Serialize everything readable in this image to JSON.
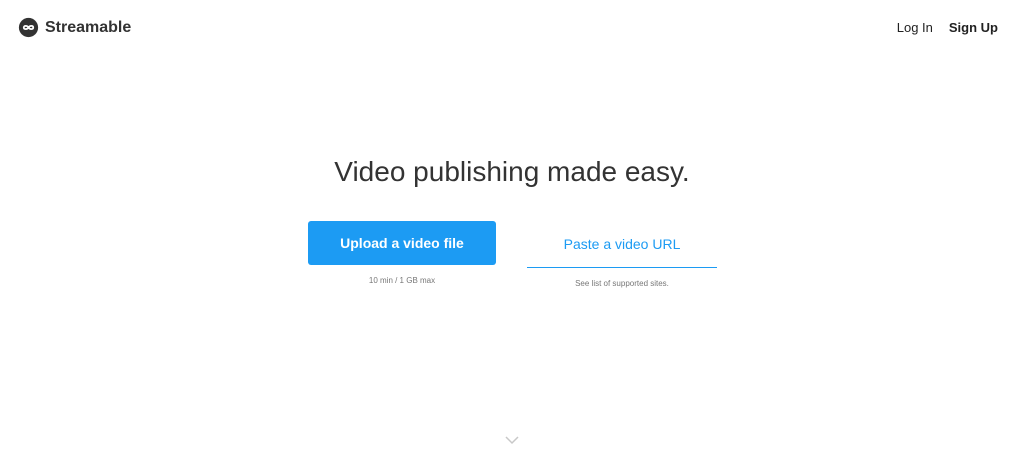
{
  "header": {
    "brand_name": "Streamable",
    "login_label": "Log In",
    "signup_label": "Sign Up"
  },
  "main": {
    "headline": "Video publishing made easy.",
    "upload_button_label": "Upload a video file",
    "upload_note": "10 min / 1 GB max",
    "url_placeholder": "Paste a video URL",
    "url_note": "See list of supported sites."
  },
  "icons": {
    "brand": "streamable-logo-icon",
    "scroll": "chevron-down-icon"
  },
  "colors": {
    "accent": "#1c9bf3",
    "text": "#333333",
    "muted": "#777777"
  }
}
